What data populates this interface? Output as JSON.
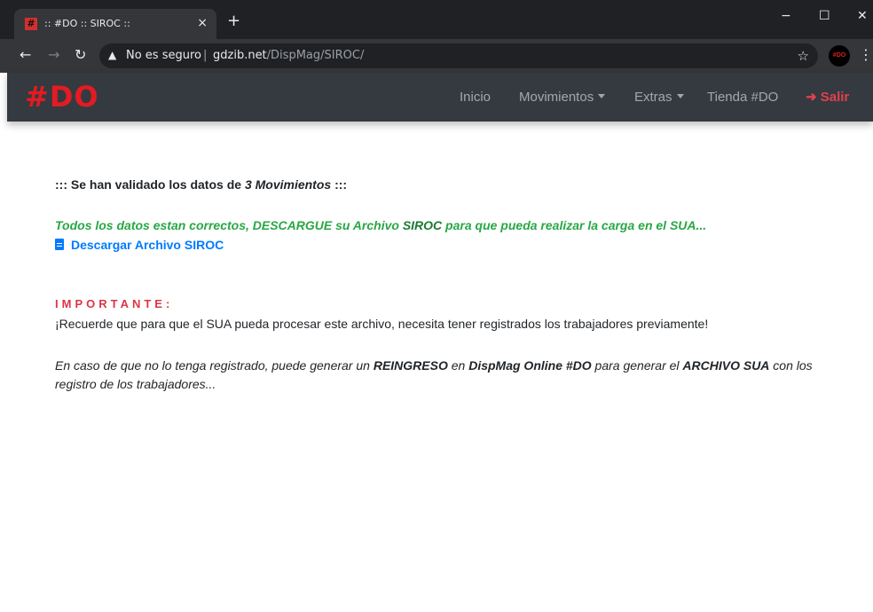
{
  "browser": {
    "tab_title": ":: #DO :: SIROC ::",
    "tab_close": "×",
    "new_tab": "+",
    "favicon_glyph": "#",
    "window_minimize": "−",
    "window_maximize": "☐",
    "window_close": "✕",
    "security_label": "No es seguro",
    "url_separator": "|",
    "url_host": "gdzib.net",
    "url_path": "/DispMag/SIROC/",
    "profile_label": "#DO"
  },
  "navbar": {
    "brand": "#DO",
    "items": [
      {
        "label": "Inicio"
      },
      {
        "label": "Movimientos"
      },
      {
        "label": "Extras"
      },
      {
        "label": "Tienda #DO"
      }
    ],
    "logout_label": "Salir",
    "brand_color": "#e31b23"
  },
  "content": {
    "validated_prefix": "::: Se han validado los datos de ",
    "validated_count": "3 Movimientos",
    "validated_suffix": " :::",
    "success_part1": "Todos los datos estan correctos, DESCARGUE su Archivo ",
    "success_siroc": "SIROC",
    "success_part2": " para que pueda realizar la carga en el SUA...",
    "download_label": "Descargar Archivo SIROC",
    "important_label": "IMPORTANTE:",
    "remember_text": "¡Recuerde que para que el SUA pueda procesar este archivo, necesita tener registrados los trabajadores previamente!",
    "case_part1": "En caso de que no lo tenga registrado, puede generar un ",
    "case_reingreso": "REINGRESO",
    "case_part2": " en ",
    "case_dispmag": "DispMag Online #DO",
    "case_part3": " para generar el ",
    "case_archivo": "ARCHIVO SUA",
    "case_part4": " con los registro de los trabajadores..."
  }
}
